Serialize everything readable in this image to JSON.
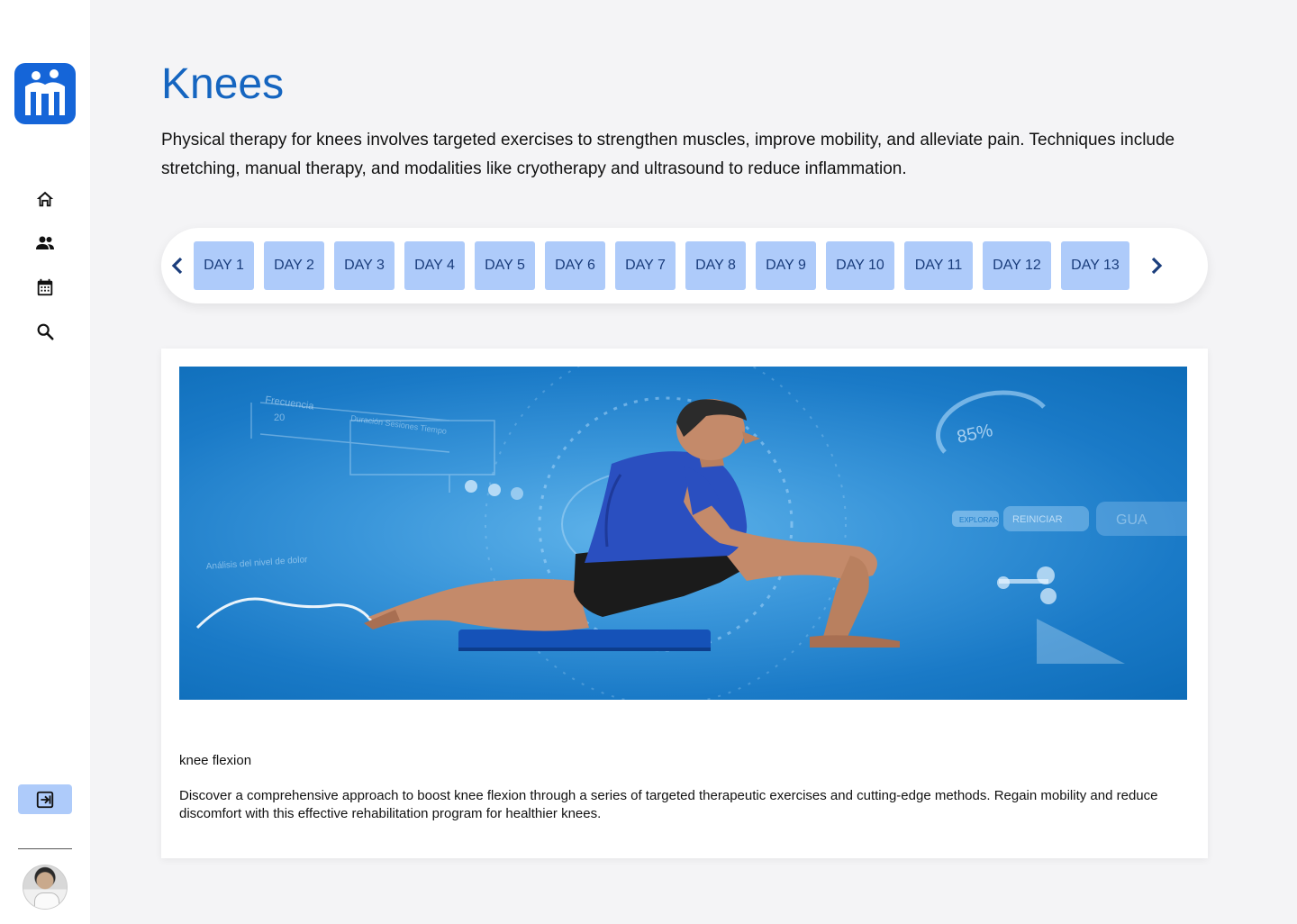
{
  "sidebar": {
    "logo": "clinic-logo",
    "nav": [
      {
        "name": "home",
        "icon": "home-icon"
      },
      {
        "name": "patients",
        "icon": "people-icon"
      },
      {
        "name": "calendar",
        "icon": "calendar-icon"
      },
      {
        "name": "search",
        "icon": "search-icon"
      }
    ],
    "logout_icon": "logout-icon",
    "avatar": "user-avatar"
  },
  "main": {
    "title": "Knees",
    "description": "Physical therapy for knees involves targeted exercises to strengthen muscles, improve mobility, and alleviate pain. Techniques include stretching, manual therapy, and modalities like cryotherapy and ultrasound to reduce inflammation."
  },
  "days": [
    "DAY 1",
    "DAY 2",
    "DAY 3",
    "DAY 4",
    "DAY 5",
    "DAY 6",
    "DAY 7",
    "DAY 8",
    "DAY 9",
    "DAY 10",
    "DAY 11",
    "DAY 12",
    "DAY 13"
  ],
  "exercise": {
    "name": "knee flexion",
    "description": "Discover a comprehensive approach to boost knee flexion through a series of targeted therapeutic exercises and cutting-edge methods. Regain mobility and reduce discomfort with this effective rehabilitation program for healthier knees.",
    "image_overlay": {
      "percent": "85%",
      "frequency_label": "Frecuencia",
      "frequency_value": "20",
      "table_header": "Duración  Sesiones  Tiempo",
      "buttons": [
        "EXPLORAR",
        "REINICIAR",
        "GUA"
      ],
      "chart_label": "Análisis del nivel de dolor"
    }
  },
  "colors": {
    "accent": "#1565c0",
    "day_button": "#aecbfa",
    "day_text": "#1a3d7c"
  }
}
